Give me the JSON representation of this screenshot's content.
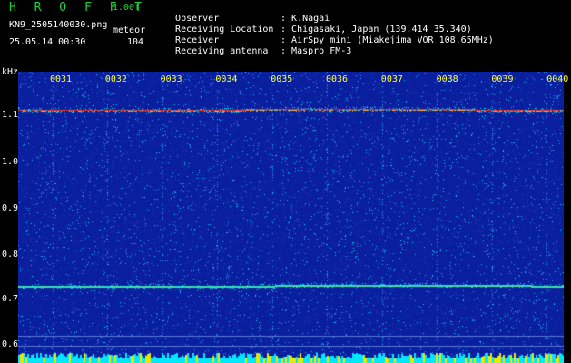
{
  "header": {
    "logo": "H R O F F T",
    "version": "1.00f",
    "filename": "KN9_2505140030.png",
    "meteor_label": "meteor",
    "datetime": "25.05.14 00:30",
    "meteor_count": "104"
  },
  "info": [
    {
      "label": "Observer",
      "value": "K.Nagai"
    },
    {
      "label": "Receiving Location",
      "value": "Chigasaki, Japan (139.414 35.340)"
    },
    {
      "label": "Receiver",
      "value": "AirSpy mini (Miakejima VOR 108.65MHz)"
    },
    {
      "label": "Receiving antenna",
      "value": "Maspro FM-3"
    }
  ],
  "axis": {
    "unit": "kHz",
    "y_labels": [
      "1.1",
      "1.0",
      "0.9",
      "0.8",
      "0.7",
      "0.6"
    ],
    "x_labels": [
      "0031",
      "0032",
      "0033",
      "0034",
      "0035",
      "0036",
      "0037",
      "0038",
      "0039",
      "0040"
    ]
  },
  "colors": {
    "background": "#0a1f9e",
    "noise_light": "#30a0ff",
    "noise_cyan": "#00e0ff",
    "band": "#f03020",
    "baseline": "#00e8ff",
    "logo": "#1fd33a"
  }
}
